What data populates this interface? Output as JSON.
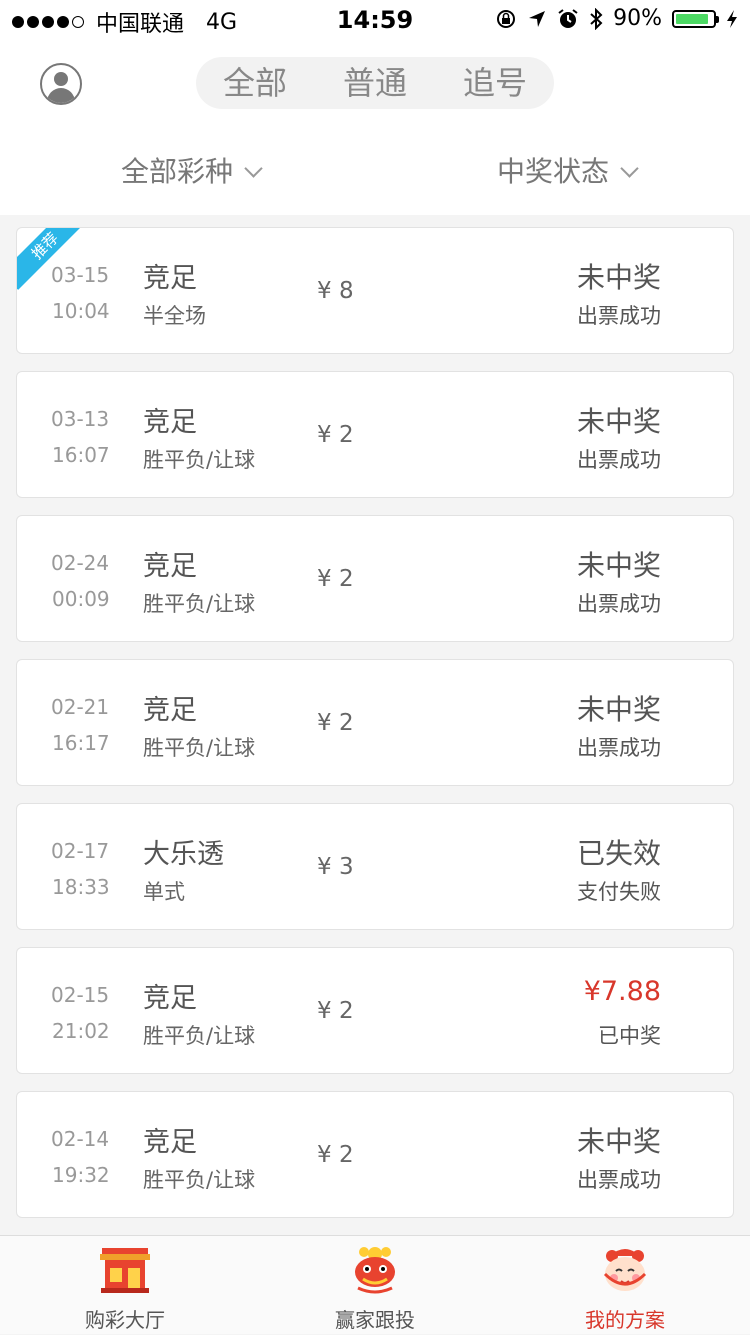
{
  "status_bar": {
    "carrier": "中国联通",
    "network": "4G",
    "time": "14:59",
    "battery": "90%",
    "battery_level": 0.9
  },
  "header": {
    "segments": [
      {
        "label": "全部",
        "active": true
      },
      {
        "label": "普通",
        "active": false
      },
      {
        "label": "追号",
        "active": false
      }
    ],
    "filters": {
      "lottery": "全部彩种",
      "status": "中奖状态"
    }
  },
  "colors": {
    "accent": "#ff8f1f",
    "win": "#d8372b",
    "ribbon": "#2ab6e8"
  },
  "orders": [
    {
      "date": "03-15",
      "time": "10:04",
      "name": "竞足",
      "play": "半全场",
      "amount": "¥ 8",
      "status": "未中奖",
      "sub": "出票成功",
      "badge": "推荐",
      "win": false
    },
    {
      "date": "03-13",
      "time": "16:07",
      "name": "竞足",
      "play": "胜平负/让球",
      "amount": "¥ 2",
      "status": "未中奖",
      "sub": "出票成功",
      "win": false
    },
    {
      "date": "02-24",
      "time": "00:09",
      "name": "竞足",
      "play": "胜平负/让球",
      "amount": "¥ 2",
      "status": "未中奖",
      "sub": "出票成功",
      "win": false
    },
    {
      "date": "02-21",
      "time": "16:17",
      "name": "竞足",
      "play": "胜平负/让球",
      "amount": "¥ 2",
      "status": "未中奖",
      "sub": "出票成功",
      "win": false
    },
    {
      "date": "02-17",
      "time": "18:33",
      "name": "大乐透",
      "play": "单式",
      "amount": "¥ 3",
      "status": "已失效",
      "sub": "支付失败",
      "win": false
    },
    {
      "date": "02-15",
      "time": "21:02",
      "name": "竞足",
      "play": "胜平负/让球",
      "amount": "¥ 2",
      "status": "¥7.88",
      "sub": "已中奖",
      "win": true
    },
    {
      "date": "02-14",
      "time": "19:32",
      "name": "竞足",
      "play": "胜平负/让球",
      "amount": "¥ 2",
      "status": "未中奖",
      "sub": "出票成功",
      "win": false
    }
  ],
  "tabbar": [
    {
      "label": "购彩大厅",
      "icon": "store-icon",
      "active": false
    },
    {
      "label": "赢家跟投",
      "icon": "lion-dance-icon",
      "active": false
    },
    {
      "label": "我的方案",
      "icon": "lucky-child-icon",
      "active": true
    }
  ]
}
